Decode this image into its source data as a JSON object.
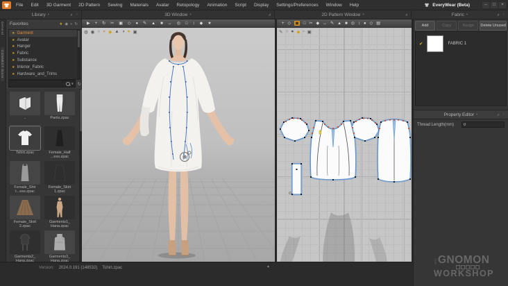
{
  "app_title": "EveryWear (Beta)",
  "window_controls": {
    "minimize": "–",
    "maximize": "□",
    "close": "×"
  },
  "menubar": {
    "items": [
      "File",
      "Edit",
      "3D Garment",
      "2D Pattern",
      "Sewing",
      "Materials",
      "Avatar",
      "Retopology",
      "Animation",
      "Script",
      "Display",
      "Settings/Preferences",
      "Window",
      "Help"
    ]
  },
  "tabs": {
    "library": "Library",
    "viewport3d": "3D Window",
    "pattern2d": "2D Pattern Window",
    "fabric": "Fabric",
    "caret": "▾"
  },
  "pane_icons": {
    "float": "◢",
    "close": "×"
  },
  "sidebar": {
    "vertical_tabs": [
      "General",
      "CONNECT Store"
    ],
    "favorites_title": "Favorites",
    "header_icons": [
      "★",
      "◉",
      "+",
      "↻"
    ],
    "favorites": [
      {
        "label": "Garment",
        "selected": true
      },
      {
        "label": "Avatar"
      },
      {
        "label": "Hanger"
      },
      {
        "label": "Fabric"
      },
      {
        "label": "Substance"
      },
      {
        "label": "Interior_Fabric"
      },
      {
        "label": "Hardware_and_Trims"
      },
      {
        "label": ""
      }
    ],
    "search_icons": {
      "caret": "▾",
      "refresh": "↻",
      "listview": "▤"
    },
    "files": [
      {
        "l1": "..",
        "l2": ""
      },
      {
        "l1": "Pants.zpac",
        "l2": ""
      },
      {
        "l1": "Tshirt.zpac",
        "l2": "",
        "selected": true
      },
      {
        "l1": "Female_Half",
        "l2": "...ess.zpac"
      },
      {
        "l1": "Female_Shir",
        "l2": "t...ess.zpac"
      },
      {
        "l1": "Female_Skirt",
        "l2": "1.zpac"
      },
      {
        "l1": "Female_Skirt",
        "l2": "2.zpac"
      },
      {
        "l1": "Garments1_",
        "l2": "Hana.zpac"
      },
      {
        "l1": "Garments2_",
        "l2": "Hana.zpac"
      },
      {
        "l1": "Garments3_",
        "l2": "Hana.zpac"
      }
    ]
  },
  "toolbar3d": {
    "icons": [
      "▶",
      "+",
      "↻",
      "✂",
      "▣",
      "◇",
      "●",
      "✎",
      "▲",
      "■",
      "↔",
      "◎",
      "□",
      "↕",
      "◆",
      "★"
    ]
  },
  "display3d": {
    "icons": [
      "◍",
      "◉",
      "○",
      {
        "glyph": "●",
        "cls": "skin"
      },
      {
        "glyph": "◆",
        "cls": "gold"
      },
      "▲",
      "◑",
      {
        "glyph": "●",
        "cls": "gold"
      },
      "▣"
    ]
  },
  "toolbar2d": {
    "icons": [
      "+",
      "◇",
      {
        "glyph": "▣",
        "cls": "hl"
      },
      "□",
      "✂",
      "◆",
      "↔",
      "✎",
      "▲",
      "■",
      "◎",
      "↕",
      "●",
      "◇",
      "▤"
    ]
  },
  "tools2d_sub": {
    "icons": [
      "✎",
      "○",
      "●",
      {
        "glyph": "◆",
        "cls": "gold"
      },
      "▫",
      "▣"
    ]
  },
  "fabric_panel": {
    "buttons": [
      {
        "label": "Add",
        "enabled": true
      },
      {
        "label": "Copy",
        "enabled": false
      },
      {
        "label": "Assign",
        "enabled": false
      },
      {
        "label": "Delete Unused",
        "enabled": true
      }
    ],
    "check_glyph": "✔",
    "items": [
      {
        "label": "FABRIC 1",
        "checked": true
      }
    ]
  },
  "property_editor": {
    "title": "Property Editor",
    "fields": [
      {
        "label": "Thread Length(mm)",
        "value": "0"
      }
    ]
  },
  "statusbar": {
    "version_label": "Version:",
    "version": "2024.0.191 (148532)",
    "file": "Tshirt.zpac",
    "timeline_toggle": "▲"
  },
  "watermark": {
    "the": "THE",
    "name": "GNOMON",
    "sub": "WORKSHOP"
  }
}
